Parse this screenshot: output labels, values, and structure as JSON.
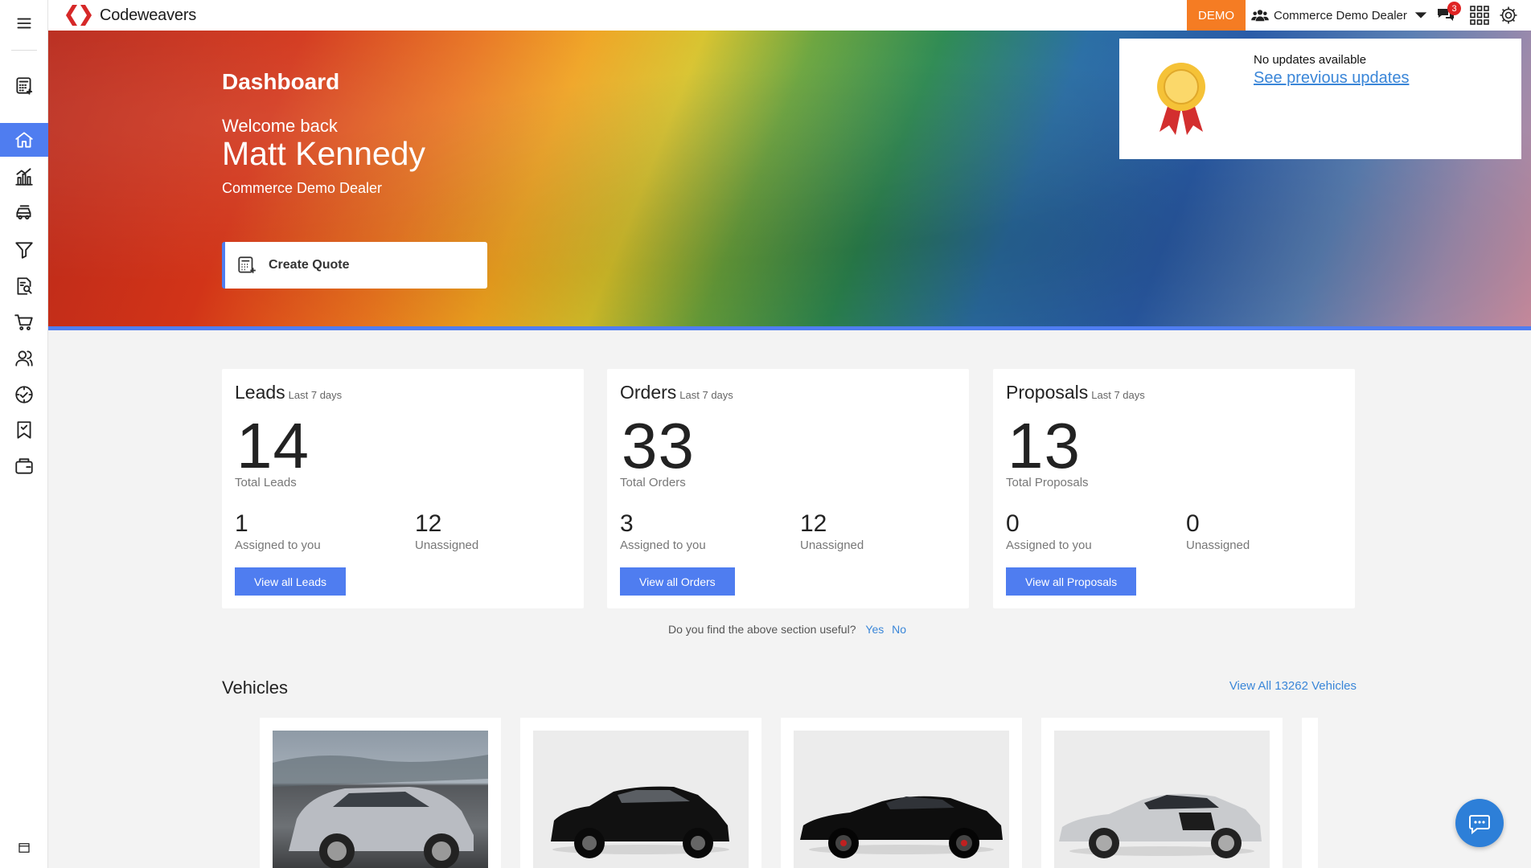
{
  "app": {
    "name": "Codeweavers"
  },
  "topbar": {
    "demo_label": "DEMO",
    "dealer": "Commerce Demo Dealer",
    "notification_count": "3"
  },
  "sidebar": {
    "items": [
      {
        "icon": "menu-icon"
      },
      {
        "icon": "calculator-icon"
      },
      {
        "icon": "home-icon",
        "active": true
      },
      {
        "icon": "analytics-icon"
      },
      {
        "icon": "car-icon"
      },
      {
        "icon": "funnel-icon"
      },
      {
        "icon": "document-search-icon"
      },
      {
        "icon": "cart-icon"
      },
      {
        "icon": "users-icon"
      },
      {
        "icon": "badge-check-icon"
      },
      {
        "icon": "bookmark-icon"
      },
      {
        "icon": "wallet-icon"
      },
      {
        "icon": "window-icon"
      }
    ]
  },
  "hero": {
    "title": "Dashboard",
    "welcome": "Welcome back",
    "user_name": "Matt Kennedy",
    "dealer": "Commerce Demo Dealer",
    "create_quote_label": "Create Quote"
  },
  "updates": {
    "title": "No updates available",
    "link": "See previous updates"
  },
  "stats": [
    {
      "title": "Leads",
      "period": "Last 7 days",
      "total": "14",
      "total_label": "Total Leads",
      "assigned": "1",
      "assigned_label": "Assigned to you",
      "unassigned": "12",
      "unassigned_label": "Unassigned",
      "button": "View all Leads"
    },
    {
      "title": "Orders",
      "period": "Last 7 days",
      "total": "33",
      "total_label": "Total Orders",
      "assigned": "3",
      "assigned_label": "Assigned to you",
      "unassigned": "12",
      "unassigned_label": "Unassigned",
      "button": "View all Orders"
    },
    {
      "title": "Proposals",
      "period": "Last 7 days",
      "total": "13",
      "total_label": "Total Proposals",
      "assigned": "0",
      "assigned_label": "Assigned to you",
      "unassigned": "0",
      "unassigned_label": "Unassigned",
      "button": "View all Proposals"
    }
  ],
  "feedback": {
    "question": "Do you find the above section useful?",
    "yes": "Yes",
    "no": "No"
  },
  "vehicles": {
    "title": "Vehicles",
    "view_all": "View All 13262 Vehicles",
    "cards": [
      {
        "color": "#b9bcc2",
        "type": "hatchback-photo"
      },
      {
        "color": "#111111",
        "type": "hatchback"
      },
      {
        "color": "#0e0e0e",
        "type": "sports-convertible"
      },
      {
        "color": "#c9cbce",
        "type": "sports-coupe"
      }
    ]
  },
  "colors": {
    "accent": "#4f7df0",
    "demo": "#f57c23",
    "link": "#3a86d8",
    "badge": "#e02424"
  }
}
